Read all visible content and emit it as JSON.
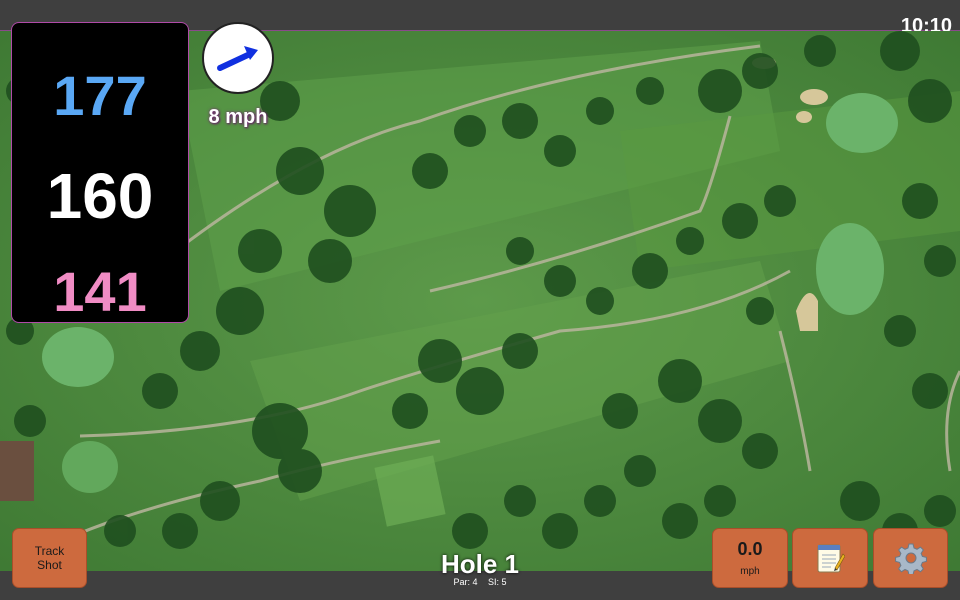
{
  "status_bar": {
    "time": "10:10"
  },
  "yardages": {
    "back": "177",
    "middle": "160",
    "front": "141"
  },
  "wind": {
    "speed": "8 mph",
    "icon": "wind-arrow-icon"
  },
  "buttons": {
    "track_shot_line1": "Track",
    "track_shot_line2": "Shot",
    "speed_value": "0.0",
    "speed_unit": "mph",
    "notes_icon": "notepad-icon",
    "settings_icon": "gear-icon"
  },
  "hole": {
    "title": "Hole 1",
    "par": "Par: 4",
    "si": "SI: 5"
  },
  "colors": {
    "back_yardage": "#5aa8f5",
    "middle_yardage": "#ffffff",
    "front_yardage": "#f08cc4",
    "button_orange": "#cd6a3e",
    "fairway_green": "#4e8e3e"
  }
}
